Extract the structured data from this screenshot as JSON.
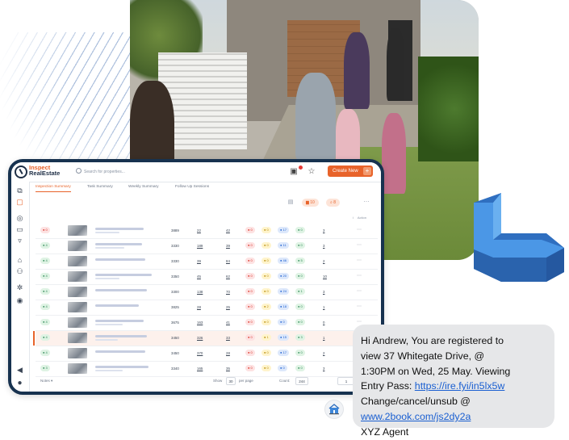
{
  "app": {
    "brand_line1": "Inspect",
    "brand_line2": "RealEstate",
    "search_placeholder": "Search for properties...",
    "create_button": "Create New",
    "create_plus": "+"
  },
  "tabs": [
    "Inspection Summary",
    "Task Summary",
    "Weekly Summary",
    "Follow Up Sessions"
  ],
  "toolbar": {
    "chip1": "10",
    "chip2": "8"
  },
  "table_header": {
    "action": "Action"
  },
  "rows": [
    {
      "id": "3889",
      "c1": "22",
      "c2": "42",
      "p1": "0",
      "p2": "0",
      "p3": "17",
      "p4": "0",
      "n": "3"
    },
    {
      "id": "3330",
      "c1": "189",
      "c2": "39",
      "p1": "0",
      "p2": "0",
      "p3": "11",
      "p4": "0",
      "n": "3"
    },
    {
      "id": "3330",
      "c1": "39",
      "c2": "84",
      "p1": "0",
      "p2": "0",
      "p3": "46",
      "p4": "5",
      "n": "2"
    },
    {
      "id": "3350",
      "c1": "45",
      "c2": "62",
      "p1": "0",
      "p2": "0",
      "p3": "20",
      "p4": "0",
      "n": "10"
    },
    {
      "id": "3300",
      "c1": "138",
      "c2": "70",
      "p1": "0",
      "p2": "0",
      "p3": "24",
      "p4": "1",
      "n": "3"
    },
    {
      "id": "3825",
      "c1": "28",
      "c2": "25",
      "p1": "0",
      "p2": "2",
      "p3": "18",
      "p4": "0",
      "n": "1"
    },
    {
      "id": "3675",
      "c1": "163",
      "c2": "41",
      "p1": "0",
      "p2": "0",
      "p3": "0",
      "p4": "0",
      "n": "0"
    },
    {
      "id": "3450",
      "c1": "326",
      "c2": "33",
      "p1": "0",
      "p2": "1",
      "p3": "15",
      "p4": "3",
      "n": "1"
    },
    {
      "id": "3450",
      "c1": "370",
      "c2": "28",
      "p1": "0",
      "p2": "0",
      "p3": "17",
      "p4": "0",
      "n": "2"
    },
    {
      "id": "3340",
      "c1": "165",
      "c2": "35",
      "p1": "0",
      "p2": "0",
      "p3": "0",
      "p4": "0",
      "n": "3"
    }
  ],
  "footer": {
    "notes": "Notes",
    "show_label": "Show",
    "show_value": "30",
    "per_page": "per page",
    "count_label": "Count:",
    "count_value": "244",
    "pager": "1"
  },
  "sms": {
    "line1": "Hi Andrew, You are registered to",
    "line2": "view 37 Whitegate Drive,  @",
    "line3": "1:30PM on Wed, 25 May. Viewing",
    "line4_prefix": "Entry Pass: ",
    "link1": "https://ire.fyi/in5lx5w",
    "line5": "Change/cancel/unsub @",
    "link2": "www.2book.com/js2dy2a",
    "line7": "XYZ Agent"
  },
  "colors": {
    "accent": "#e8632a",
    "frame": "#17324f",
    "link": "#1a5fd1",
    "shape": "#3d86d9"
  },
  "icons": [
    "logo-icon",
    "search-icon",
    "calendar-icon",
    "star-icon",
    "sidebar-icons",
    "house-icon"
  ]
}
